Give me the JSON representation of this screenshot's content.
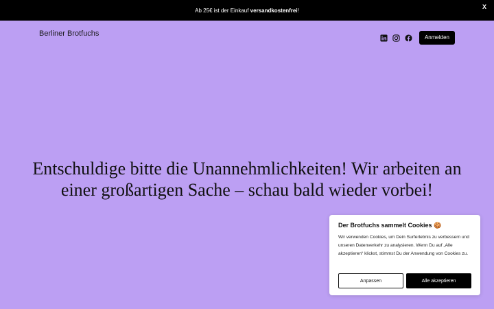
{
  "announcement": {
    "text_prefix": "Ab 25€ ist der Einkauf ",
    "text_bold": "versandkostenfrei",
    "text_suffix": "!",
    "close_label": "X"
  },
  "header": {
    "brand": "Berliner Brotfuchs",
    "social_icons": [
      "linkedin-icon",
      "instagram-icon",
      "facebook-icon"
    ],
    "login_label": "Anmelden"
  },
  "main": {
    "headline": "Entschuldige bitte die Unannehmlichkeiten! Wir arbeiten an einer großartigen Sache – schau bald wieder vorbei!"
  },
  "cookie_banner": {
    "title": "Der Brotfuchs sammelt Cookies 🍪",
    "body": "Wir verwenden Cookies, um Dein Surferlebnis zu verbessern und unseren Datenverkehr zu analysieren. Wenn Du auf „Alle akzeptieren“ klickst, stimmst Du der Anwendung von Cookies zu.",
    "adjust_label": "Anpassen",
    "accept_label": "Alle akzeptieren"
  },
  "colors": {
    "background": "#bc9ff3",
    "topbar": "#000000",
    "button": "#000000"
  }
}
